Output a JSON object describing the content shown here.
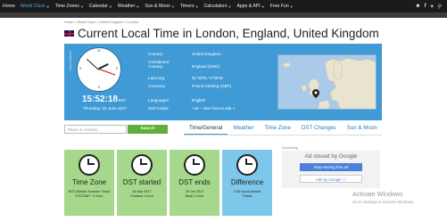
{
  "nav": {
    "items": [
      {
        "label": "Home",
        "active": false
      },
      {
        "label": "World Clock",
        "active": true
      },
      {
        "label": "Time Zones",
        "active": false
      },
      {
        "label": "Calendar",
        "active": false
      },
      {
        "label": "Weather",
        "active": false
      },
      {
        "label": "Sun & Moon",
        "active": false
      },
      {
        "label": "Timers",
        "active": false
      },
      {
        "label": "Calculators",
        "active": false
      },
      {
        "label": "Apps & API",
        "active": false
      },
      {
        "label": "Free Fun",
        "active": false
      }
    ],
    "icons": [
      "user-icon",
      "facebook-icon",
      "twitter-icon",
      "search-icon"
    ]
  },
  "breadcrumb": "Home  >  World Clock  >  United Kingdom  >  London",
  "title": "Current Local Time in London, England, United Kingdom",
  "clock": {
    "time": "15:52:18",
    "zone": "BST",
    "date": "Thursday, 22 June 2017",
    "brand": "timeanddate"
  },
  "info": {
    "country_label": "Country:",
    "country": "United Kingdom",
    "constituent_label": "Constituent",
    "constituent_label2": "Country:",
    "constituent": "England (ENG)",
    "latlong_label": "Lat/Long:",
    "latlong": "51°30'N / 0°08'W",
    "currency_label": "Currency:",
    "currency": "Pound Sterling (GBP)",
    "languages_label": "Languages:",
    "languages": "English",
    "dial_label": "Dial Codes:",
    "dial": "+44",
    "dial_link": "See how to dial"
  },
  "search": {
    "placeholder": "Place or country...",
    "button": "Search"
  },
  "tabs": [
    "Time/General",
    "Weather",
    "Time Zone",
    "DST Changes",
    "Sun & Moon"
  ],
  "cards": [
    {
      "title": "Time Zone",
      "line1": "BST (British Summer Time)",
      "line2": "UTC/GMT +1 hour",
      "color": "#a6d88b"
    },
    {
      "title": "DST started",
      "line1": "26 Mar 2017",
      "line2": "Forward 1 hour",
      "color": "#a6d88b"
    },
    {
      "title": "DST ends",
      "line1": "29 Oct 2017",
      "line2": "Back 1 hour",
      "color": "#a6d88b"
    },
    {
      "title": "Difference",
      "line1": "4:30 hours behind",
      "line2": "Patna",
      "color": "#7cc7ea"
    }
  ],
  "ad": {
    "label": "Advertising",
    "closed": "Ad closed by Google",
    "stop": "Stop seeing this ad",
    "why": "Ads by Google ⓘ"
  },
  "watermark": {
    "line1": "Activate Windows",
    "line2": "Go to Settings to activate Windows."
  },
  "colors": {
    "nav_bg": "#1b1b1b",
    "accent": "#3f9ad6",
    "search_button": "#5fae3a",
    "card_green": "#a6d88b",
    "card_blue": "#7cc7ea"
  }
}
